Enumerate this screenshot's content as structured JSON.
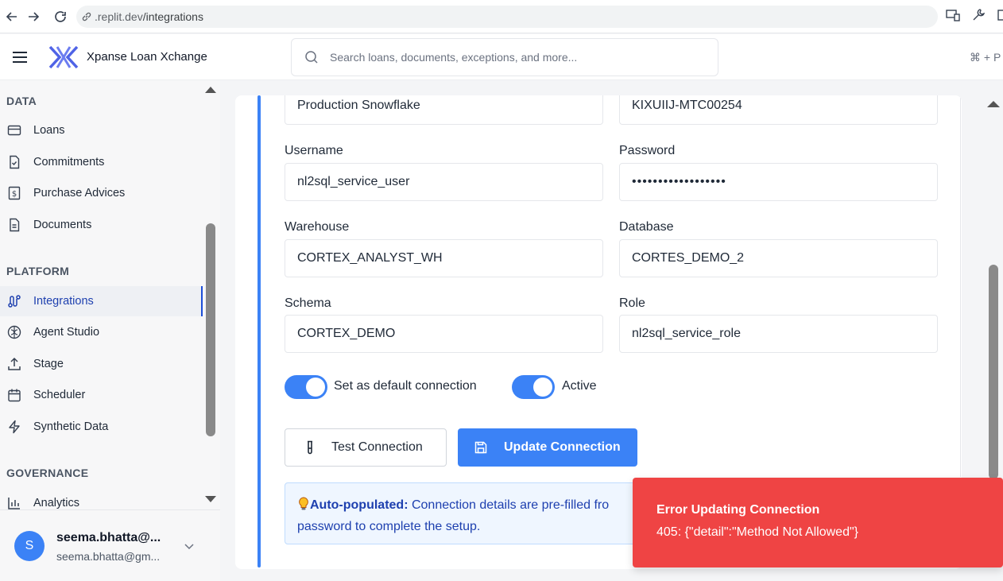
{
  "browser": {
    "url_prefix": ".replit.dev",
    "url_path": "/integrations"
  },
  "header": {
    "app_title": "Xpanse Loan Xchange",
    "search_placeholder": "Search loans, documents, exceptions, and more...",
    "shortcut": "⌘ + P"
  },
  "sidebar": {
    "sections": {
      "data": "DATA",
      "platform": "PLATFORM",
      "governance": "GOVERNANCE"
    },
    "items": {
      "loans": "Loans",
      "commitments": "Commitments",
      "purchase_advices": "Purchase Advices",
      "documents": "Documents",
      "integrations": "Integrations",
      "agent_studio": "Agent Studio",
      "stage": "Stage",
      "scheduler": "Scheduler",
      "synthetic_data": "Synthetic Data",
      "analytics": "Analytics"
    },
    "active_item": "Integrations"
  },
  "user": {
    "initial": "S",
    "name": "seema.bhatta@...",
    "email": "seema.bhatta@gm..."
  },
  "form": {
    "connection_name": "Production Snowflake",
    "account": "KIXUIIJ-MTC00254",
    "username_label": "Username",
    "username": "nl2sql_service_user",
    "password_label": "Password",
    "password_mask": "••••••••••••••••••",
    "warehouse_label": "Warehouse",
    "warehouse": "CORTEX_ANALYST_WH",
    "database_label": "Database",
    "database": "CORTES_DEMO_2",
    "schema_label": "Schema",
    "schema": "CORTEX_DEMO",
    "role_label": "Role",
    "role": "nl2sql_service_role",
    "default_toggle_label": "Set as default connection",
    "default_toggle_on": true,
    "active_toggle_label": "Active",
    "active_toggle_on": true,
    "test_button": "Test Connection",
    "update_button": "Update Connection"
  },
  "info": {
    "bold": "Auto-populated:",
    "text_line1": " Connection details are pre-filled fro",
    "text_line2": "password to complete the setup."
  },
  "toast": {
    "title": "Error Updating Connection",
    "message": "405: {\"detail\":\"Method Not Allowed\"}"
  },
  "colors": {
    "accent": "#3b82f6",
    "active_nav": "#1e40af",
    "toast_bg": "#ef4444"
  }
}
